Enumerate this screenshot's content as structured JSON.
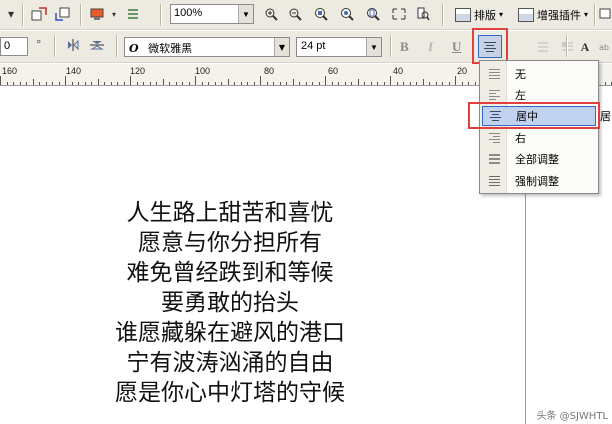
{
  "toolbar_top": {
    "zoom_value": "100%",
    "layout_menu_label": "排版",
    "enhance_plugin_label": "增强插件"
  },
  "toolbar_format": {
    "number_value": "0",
    "degree_symbol": "°",
    "font_glyph": "O",
    "font_name": "微软雅黑",
    "font_size": "24 pt",
    "bold_label": "B",
    "italic_label": "I",
    "underline_label": "U",
    "text_tool_label": "A"
  },
  "ruler": {
    "labels": [
      "160",
      "140",
      "120",
      "100",
      "80",
      "60",
      "40",
      "20"
    ]
  },
  "align_menu": {
    "items": [
      {
        "label": "无"
      },
      {
        "label": "左"
      },
      {
        "label": "居中"
      },
      {
        "label": "右"
      },
      {
        "label": "全部调整"
      },
      {
        "label": "强制调整"
      }
    ],
    "selected": "居中",
    "partial_text": "居"
  },
  "poem": {
    "lines": [
      "人生路上甜苦和喜忧",
      "愿意与你分担所有",
      "难免曾经跌到和等候",
      "要勇敢的抬头",
      "谁愿藏躲在避风的港口",
      "宁有波涛汹涌的自由",
      "愿是你心中灯塔的守候"
    ]
  },
  "watermark": "头条 @SJWHTL"
}
